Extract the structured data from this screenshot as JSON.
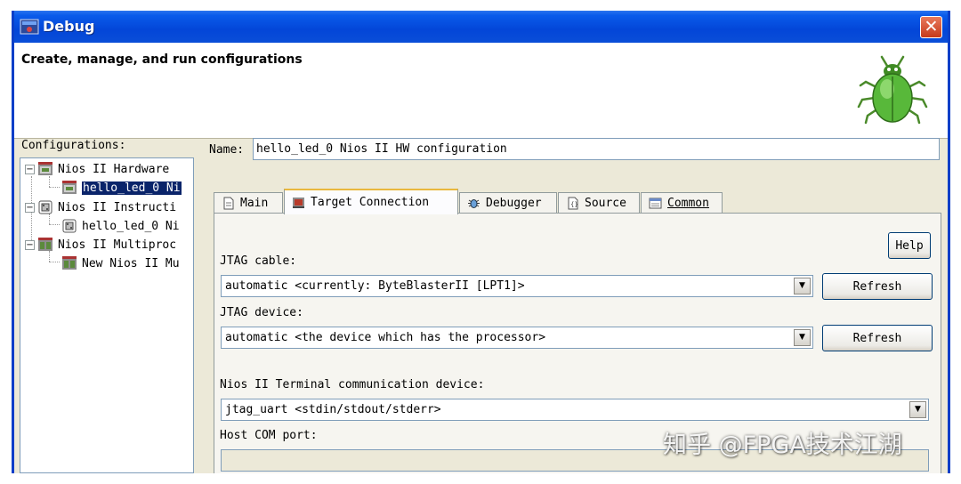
{
  "window": {
    "title": "Debug",
    "close_symbol": "✕",
    "heading": "Create, manage, and run configurations",
    "header_icon": "bug-icon"
  },
  "configurations": {
    "label": "Configurations:",
    "items": [
      {
        "label": "Nios II Hardware",
        "level": 0,
        "expanded": true,
        "icon": "hardware-config-icon"
      },
      {
        "label": "hello_led_0 Ni",
        "level": 1,
        "selected": true,
        "icon": "hardware-config-icon"
      },
      {
        "label": "Nios II Instructi",
        "level": 0,
        "expanded": true,
        "icon": "iss-config-icon"
      },
      {
        "label": "hello_led_0 Ni",
        "level": 1,
        "icon": "iss-config-icon"
      },
      {
        "label": "Nios II Multiproc",
        "level": 0,
        "expanded": true,
        "icon": "multiprocessor-config-icon"
      },
      {
        "label": "New Nios II Mu",
        "level": 1,
        "icon": "multiprocessor-config-icon"
      }
    ],
    "expander_symbol": "−"
  },
  "name": {
    "label": "Name:",
    "value": "hello_led_0 Nios II HW configuration"
  },
  "tabs": [
    {
      "label": "Main",
      "icon": "document-icon",
      "active": false
    },
    {
      "label": "Target Connection",
      "icon": "target-connection-icon",
      "active": true
    },
    {
      "label": "Debugger",
      "icon": "debugger-bug-icon",
      "active": false
    },
    {
      "label": "Source",
      "icon": "source-icon",
      "active": false
    },
    {
      "label": "Common",
      "icon": "common-icon",
      "active": false
    }
  ],
  "target_connection": {
    "help_label": "Help",
    "jtag_cable_label": "JTAG cable:",
    "jtag_cable_value": "automatic <currently: ByteBlasterII [LPT1]>",
    "jtag_device_label": "JTAG device:",
    "jtag_device_value": "automatic <the device which has the processor>",
    "refresh_label": "Refresh",
    "terminal_label": "Nios II Terminal communication device:",
    "terminal_value": "jtag_uart <stdin/stdout/stderr>",
    "host_com_label": "Host COM port:",
    "host_com_value": "",
    "dropdown_symbol": "▼"
  },
  "watermark": "知乎 @FPGA技术江湖",
  "colors": {
    "titlebar": "#0346d8",
    "selection": "#0a246a",
    "close_button": "#c6391a",
    "active_tab_accent": "#e9b83e"
  }
}
